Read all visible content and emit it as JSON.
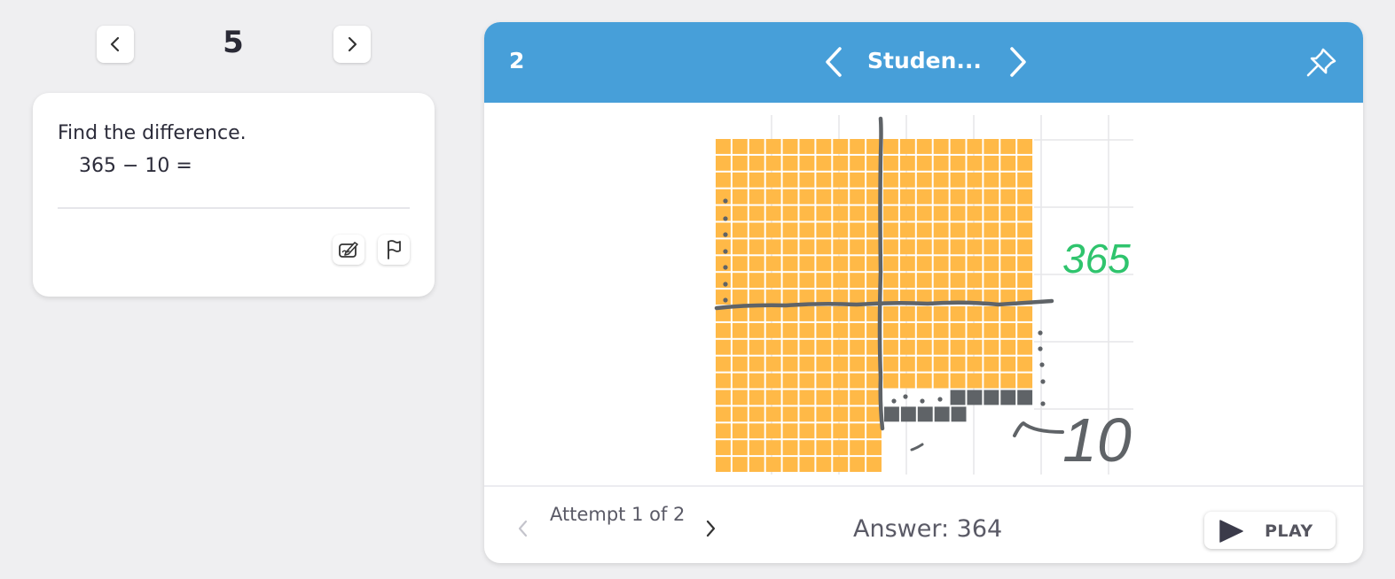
{
  "nav": {
    "question_number": "5",
    "prev_icon": "chevron-left-icon",
    "next_icon": "chevron-right-icon"
  },
  "question": {
    "prompt": "Find the difference.",
    "equation": "365 − 10 =",
    "icons": [
      "edit-icon",
      "flag-icon"
    ]
  },
  "response_panel": {
    "header": {
      "number": "2",
      "student_name": "Studen...",
      "color": "#479fd9",
      "icons": [
        "chevron-left-icon",
        "chevron-right-icon",
        "pin-icon"
      ]
    },
    "drawing": {
      "written_numbers": [
        "365",
        "10"
      ],
      "block_color": "#ffb947",
      "crossed_color": "#5f6367",
      "ink_green": "#2fc46d"
    },
    "footer": {
      "attempt_label": "Attempt 1 of 2",
      "answer": "Answer: 364",
      "play_label": "PLAY"
    }
  }
}
